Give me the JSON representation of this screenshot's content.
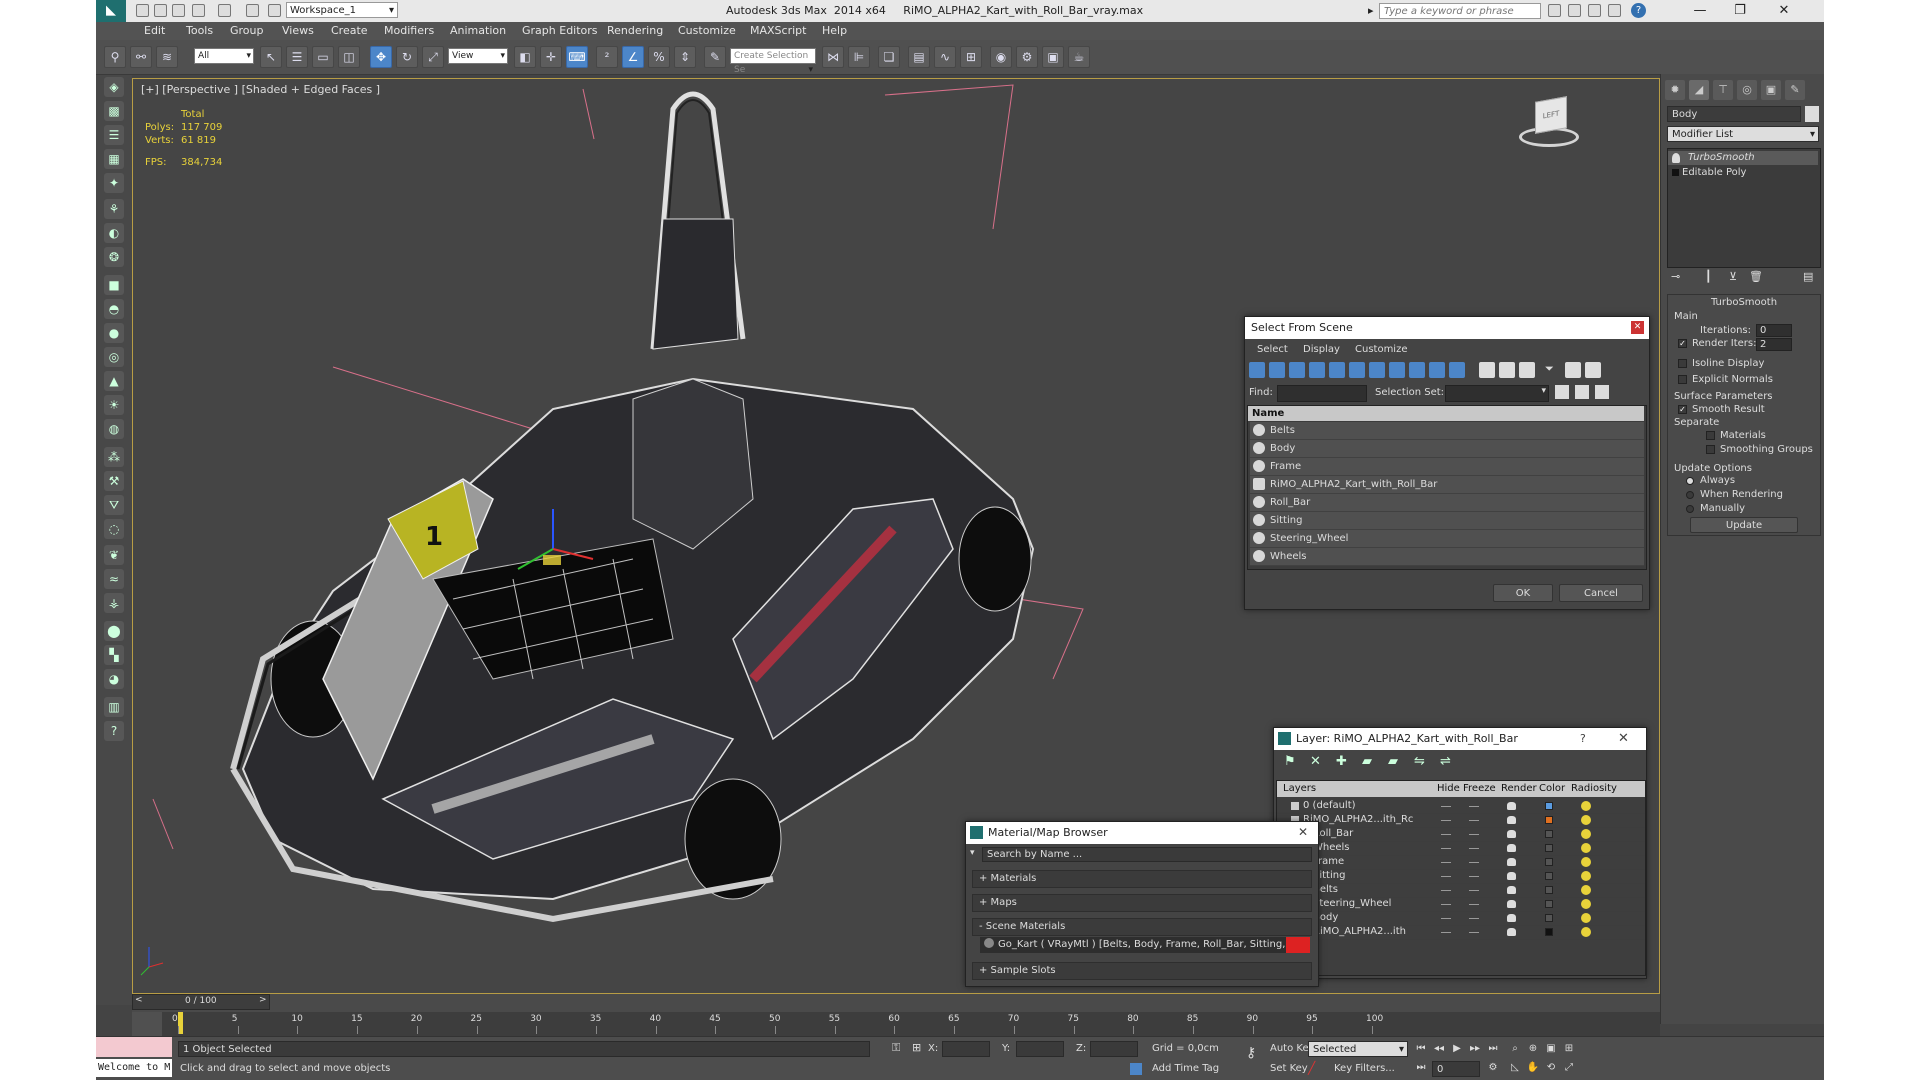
{
  "app": {
    "title": "Autodesk 3ds Max  2014 x64     RiMO_ALPHA2_Kart_with_Roll_Bar_vray.max",
    "workspace": "Workspace_1",
    "search_placeholder": "Type a keyword or phrase",
    "win_min": "—",
    "win_max": "❐",
    "win_close": "✕",
    "help": "?"
  },
  "menu": [
    "Edit",
    "Tools",
    "Group",
    "Views",
    "Create",
    "Modifiers",
    "Animation",
    "Graph Editors",
    "Rendering",
    "Customize",
    "MAXScript",
    "Help"
  ],
  "toolbar": {
    "filter": "All",
    "ref_coord": "View",
    "named_sel": "Create Selection Se"
  },
  "viewport": {
    "label": "[+] [Perspective ] [Shaded + Edged Faces ]",
    "stats_total": "Total",
    "polys_label": "Polys:",
    "polys_value": "117 709",
    "verts_label": "Verts:",
    "verts_value": "61 819",
    "fps_label": "FPS:",
    "fps_value": "384,734",
    "viewcube_label": "LEFT"
  },
  "command_panel": {
    "object_name": "Body",
    "modifier_list": "Modifier List",
    "stack": [
      "TurboSmooth",
      "Editable Poly"
    ],
    "rollout_title": "TurboSmooth",
    "main_group": "Main",
    "iterations_label": "Iterations:",
    "iterations_value": "0",
    "render_iters_label": "Render Iters:",
    "render_iters_value": "2",
    "isoline": "Isoline Display",
    "explicit_normals": "Explicit Normals",
    "surface_params": "Surface Parameters",
    "smooth_result": "Smooth Result",
    "separate": "Separate",
    "materials": "Materials",
    "smoothing_groups": "Smoothing Groups",
    "update_options": "Update Options",
    "always": "Always",
    "when_rendering": "When Rendering",
    "manually": "Manually",
    "update_button": "Update"
  },
  "select_from_scene": {
    "title": "Select From Scene",
    "tabs": [
      "Select",
      "Display",
      "Customize"
    ],
    "find_label": "Find:",
    "selection_set_label": "Selection Set:",
    "column_name": "Name",
    "items": [
      "Belts",
      "Body",
      "Frame",
      "RiMO_ALPHA2_Kart_with_Roll_Bar",
      "Roll_Bar",
      "Sitting",
      "Steering_Wheel",
      "Wheels"
    ],
    "ok": "OK",
    "cancel": "Cancel"
  },
  "layer_dialog": {
    "title": "Layer: RiMO_ALPHA2_Kart_with_Roll_Bar",
    "help": "?",
    "columns": [
      "Layers",
      "Hide",
      "Freeze",
      "Render",
      "Color",
      "Radiosity"
    ],
    "rows": [
      {
        "name": "0 (default)",
        "indent": 0,
        "color": "#5a9be0"
      },
      {
        "name": "RiMO_ALPHA2...ith_Rc",
        "indent": 0,
        "color": "#e07020"
      },
      {
        "name": "Roll_Bar",
        "indent": 1,
        "color": "#555555"
      },
      {
        "name": "Wheels",
        "indent": 1,
        "color": "#555555"
      },
      {
        "name": "Frame",
        "indent": 1,
        "color": "#555555"
      },
      {
        "name": "Sitting",
        "indent": 1,
        "color": "#555555"
      },
      {
        "name": "Belts",
        "indent": 1,
        "color": "#555555"
      },
      {
        "name": "Steering_Wheel",
        "indent": 1,
        "color": "#555555"
      },
      {
        "name": "Body",
        "indent": 1,
        "color": "#555555"
      },
      {
        "name": "RiMO_ALPHA2...ith",
        "indent": 1,
        "color": "#111111"
      }
    ]
  },
  "material_browser": {
    "title": "Material/Map Browser",
    "search_placeholder": "Search by Name ...",
    "sections": [
      "+ Materials",
      "+ Maps",
      "- Scene Materials",
      "+ Sample Slots"
    ],
    "scene_material": "Go_Kart  ( VRayMtl ) [Belts, Body, Frame, Roll_Bar, Sitting, Stee..."
  },
  "timeline": {
    "frame_label": "0 / 100",
    "ticks": [
      "0",
      "5",
      "10",
      "15",
      "20",
      "25",
      "30",
      "35",
      "40",
      "45",
      "50",
      "55",
      "60",
      "65",
      "70",
      "75",
      "80",
      "85",
      "90",
      "95",
      "100"
    ]
  },
  "status": {
    "maxscript": "Welcome to M",
    "selected": "1 Object Selected",
    "prompt": "Click and drag to select and move objects",
    "x_label": "X:",
    "y_label": "Y:",
    "z_label": "Z:",
    "grid": "Grid = 0,0cm",
    "add_time_tag": "Add Time Tag",
    "auto_key": "Auto Key",
    "set_key": "Set Key",
    "selected_dd": "Selected",
    "key_filters": "Key Filters...",
    "frame_value": "0"
  }
}
